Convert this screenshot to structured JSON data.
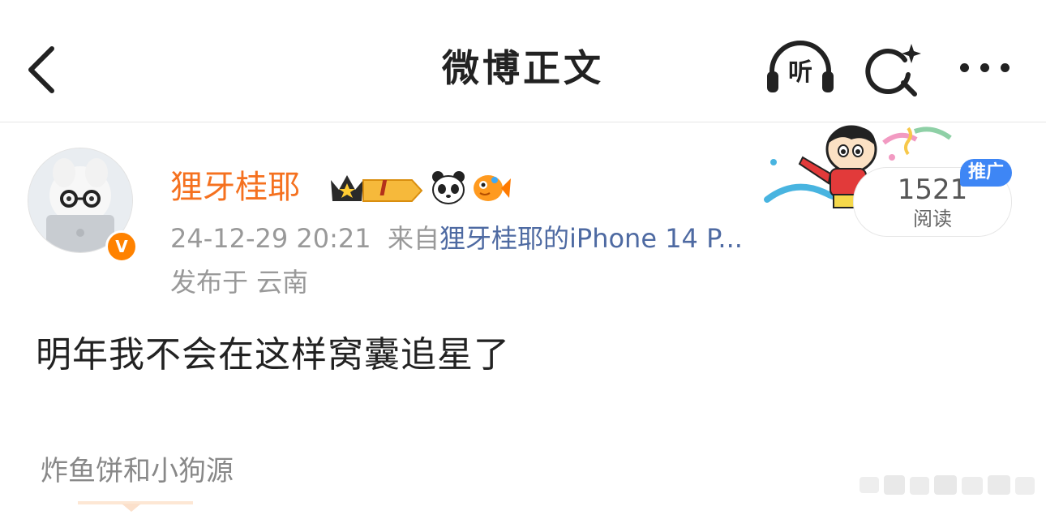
{
  "nav": {
    "title": "微博正文",
    "back_icon": "chevron-left-icon",
    "listen_label": "听",
    "search_icon": "search-sparkle-icon",
    "more_icon": "more-horizontal-icon"
  },
  "post": {
    "author": "狸牙桂耶",
    "verified_badge": "V",
    "member_badge_level": "I",
    "timestamp": "24-12-29 20:21",
    "source_prefix": "来自",
    "source": "狸牙桂耶的iPhone 14 P...",
    "location": "发布于 云南",
    "text": "明年我不会在这样窝囊追星了",
    "tag": "炸鱼饼和小狗源"
  },
  "ad": {
    "read_count": "1521",
    "read_label": "阅读",
    "promo_label": "推广"
  },
  "colors": {
    "username": "#f5711f",
    "source_link": "#4e6aa2",
    "verified": "#ff8200",
    "promo": "#3e86f5"
  }
}
